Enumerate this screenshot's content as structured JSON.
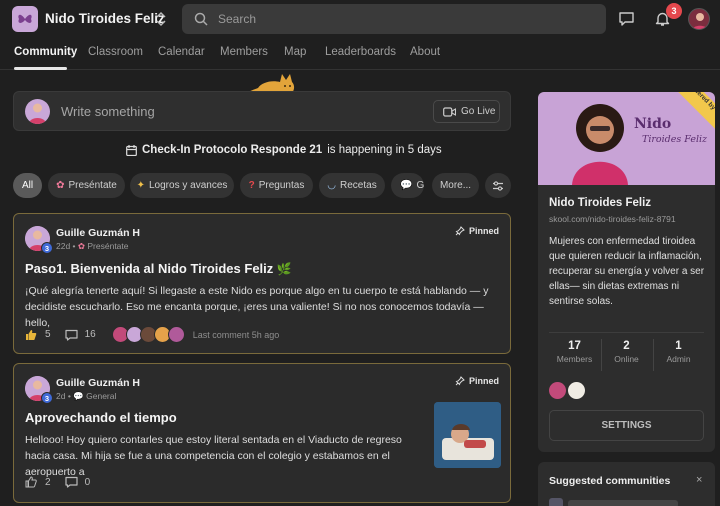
{
  "header": {
    "group_name": "Nido Tiroides Feliz",
    "search_placeholder": "Search",
    "notification_count": "3"
  },
  "tabs": [
    {
      "label": "Community",
      "active": true
    },
    {
      "label": "Classroom"
    },
    {
      "label": "Calendar"
    },
    {
      "label": "Members"
    },
    {
      "label": "Map"
    },
    {
      "label": "Leaderboards"
    },
    {
      "label": "About"
    }
  ],
  "composer": {
    "placeholder": "Write something",
    "go_live": "Go Live"
  },
  "event": {
    "name": "Check-In Protocolo Responde 21",
    "suffix": "is happening in 5 days"
  },
  "filters": [
    {
      "label": "All",
      "active": true
    },
    {
      "label": "Preséntate",
      "icon": "flower-icon"
    },
    {
      "label": "Logros y avances",
      "icon": "party-icon"
    },
    {
      "label": "Preguntas",
      "icon": "question-icon"
    },
    {
      "label": "Recetas",
      "icon": "bowl-icon"
    },
    {
      "label": "Ge",
      "icon": "speech-icon"
    },
    {
      "label": "More..."
    }
  ],
  "posts": [
    {
      "author": "Guille Guzmán H",
      "level": "3",
      "time": "22d",
      "category": "Preséntate",
      "category_icon": "flower-icon",
      "pinned": "Pinned",
      "title": "Paso1. Bienvenida al Nido Tiroides Feliz",
      "body": "¡Qué alegría tenerte aquí! Si llegaste a este Nido es porque algo en tu cuerpo te está hablando — y decidiste escucharlo. Eso me encanta porque, ¡eres una valiente! Si no nos conocemos todavía — hello,",
      "likes": "5",
      "comments": "16",
      "last_comment": "Last comment 5h ago"
    },
    {
      "author": "Guille Guzmán H",
      "level": "3",
      "time": "2d",
      "category": "General",
      "category_icon": "speech-icon",
      "pinned": "Pinned",
      "title": "Aprovechando el tiempo",
      "body": "Hellooo! Hoy quiero contarles que estoy literal sentada en el Viaducto de regreso hacia casa. Mi hija se fue a una competencia con el colegio y estabamos en el aeropuerto a",
      "likes": "2",
      "comments": "0"
    }
  ],
  "group_card": {
    "cover_title": "Nido",
    "cover_subtitle": "Tiroides Feliz",
    "ribbon": "powered by skool",
    "name": "Nido Tiroides Feliz",
    "url": "skool.com/nido-tiroides-feliz-8791",
    "description": "Mujeres con enfermedad tiroidea que quieren reducir la inflamación, recuperar su energía y volver a ser ellas— sin dietas extremas ni sentirse solas.",
    "stats": [
      {
        "value": "17",
        "label": "Members"
      },
      {
        "value": "2",
        "label": "Online"
      },
      {
        "value": "1",
        "label": "Admin"
      }
    ],
    "settings": "SETTINGS"
  },
  "suggested": {
    "title": "Suggested communities",
    "close": "×"
  },
  "colors": {
    "accent_gold": "#7a6a3b",
    "badge_red": "#e5484d",
    "level_blue": "#3f6ad8"
  }
}
